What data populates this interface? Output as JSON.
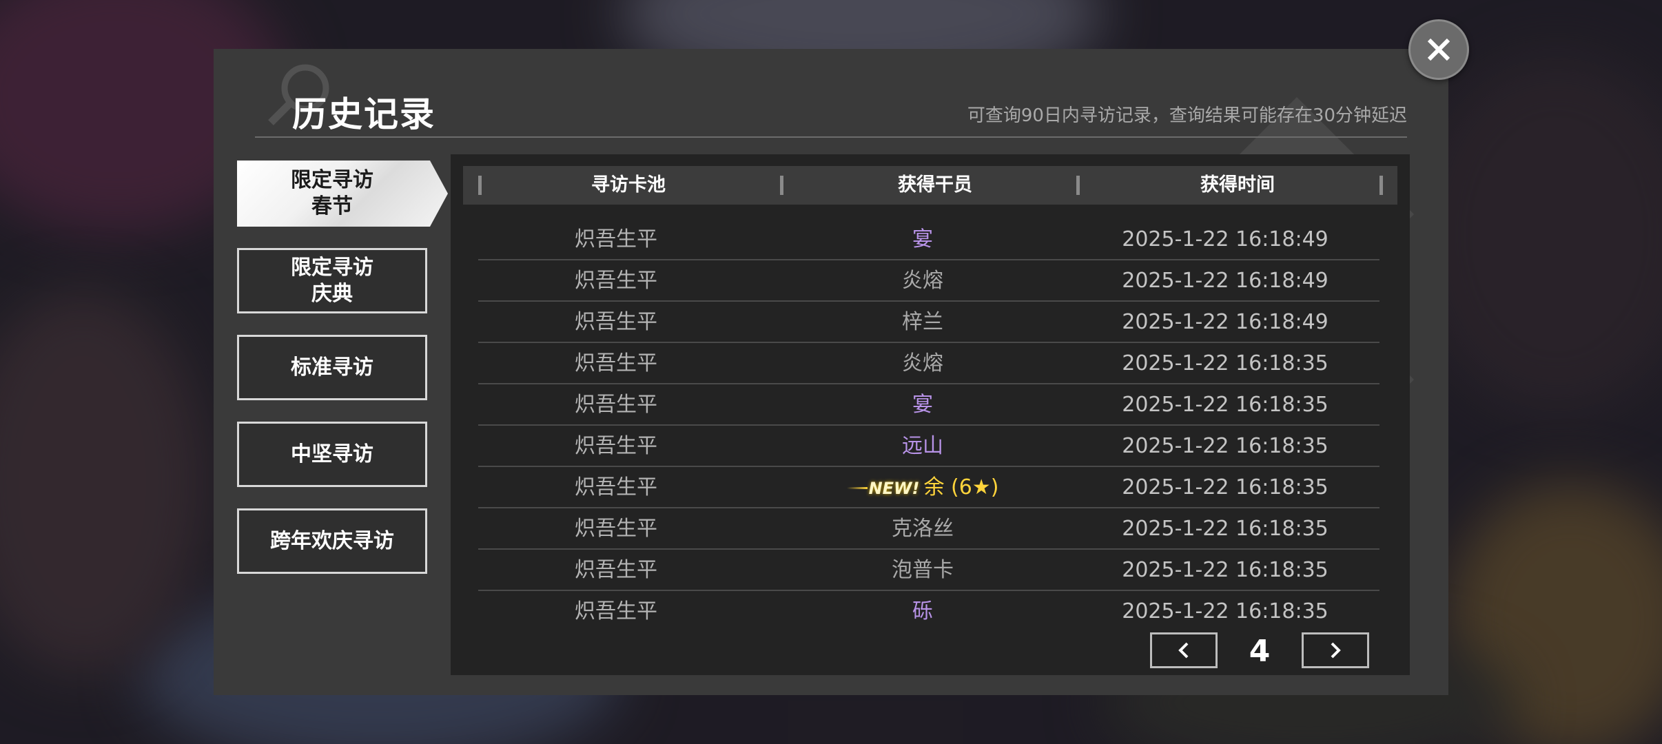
{
  "header": {
    "title": "历史记录",
    "subtitle": "可查询90日内寻访记录，查询结果可能存在30分钟延迟"
  },
  "tabs": [
    {
      "label": "限定寻访\n春节",
      "active": true
    },
    {
      "label": "限定寻访\n庆典",
      "active": false
    },
    {
      "label": "标准寻访",
      "active": false
    },
    {
      "label": "中坚寻访",
      "active": false
    },
    {
      "label": "跨年欢庆寻访",
      "active": false
    }
  ],
  "table": {
    "columns": [
      "寻访卡池",
      "获得干员",
      "获得时间"
    ],
    "rows": [
      {
        "pool": "炽吾生平",
        "operator": "宴",
        "rarity": 4,
        "time": "2025-1-22 16:18:49"
      },
      {
        "pool": "炽吾生平",
        "operator": "炎熔",
        "rarity": 3,
        "time": "2025-1-22 16:18:49"
      },
      {
        "pool": "炽吾生平",
        "operator": "梓兰",
        "rarity": 3,
        "time": "2025-1-22 16:18:49"
      },
      {
        "pool": "炽吾生平",
        "operator": "炎熔",
        "rarity": 3,
        "time": "2025-1-22 16:18:35"
      },
      {
        "pool": "炽吾生平",
        "operator": "宴",
        "rarity": 4,
        "time": "2025-1-22 16:18:35"
      },
      {
        "pool": "炽吾生平",
        "operator": "远山",
        "rarity": 4,
        "time": "2025-1-22 16:18:35"
      },
      {
        "pool": "炽吾生平",
        "operator": "余 (6★)",
        "rarity": 6,
        "is_new": true,
        "new_label": "NEW!",
        "time": "2025-1-22 16:18:35"
      },
      {
        "pool": "炽吾生平",
        "operator": "克洛丝",
        "rarity": 3,
        "time": "2025-1-22 16:18:35"
      },
      {
        "pool": "炽吾生平",
        "operator": "泡普卡",
        "rarity": 3,
        "time": "2025-1-22 16:18:35"
      },
      {
        "pool": "炽吾生平",
        "operator": "砾",
        "rarity": 4,
        "time": "2025-1-22 16:18:35"
      }
    ]
  },
  "pager": {
    "page": "4",
    "prev_icon": "chevron-left-icon",
    "next_icon": "chevron-right-icon"
  },
  "close_icon": "close-icon",
  "colors": {
    "rarity4": "#b893e8",
    "rarity6": "#ffd43b",
    "rarity3": "#b4b4b4",
    "panel": "#3a3a3a",
    "table_bg": "#232323"
  }
}
